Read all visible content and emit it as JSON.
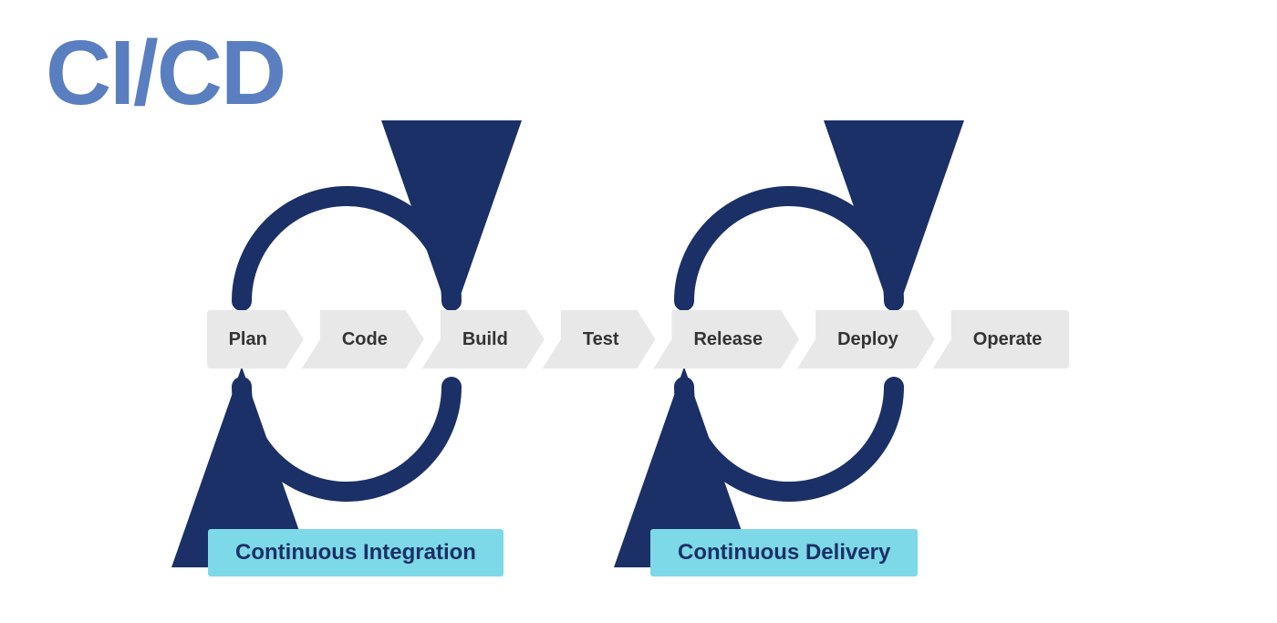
{
  "title": "CI/CD",
  "pipeline": {
    "items": [
      "Plan",
      "Code",
      "Build",
      "Test",
      "Release",
      "Deploy",
      "Operate"
    ]
  },
  "labels": {
    "ci": "Continuous Integration",
    "cd": "Continuous Delivery"
  },
  "colors": {
    "arrow_fill": "#e8e8e8",
    "circle_stroke": "#1a3066",
    "label_bg": "#7dd8e8",
    "label_text": "#1a3066",
    "title": "#5a7fc0"
  }
}
